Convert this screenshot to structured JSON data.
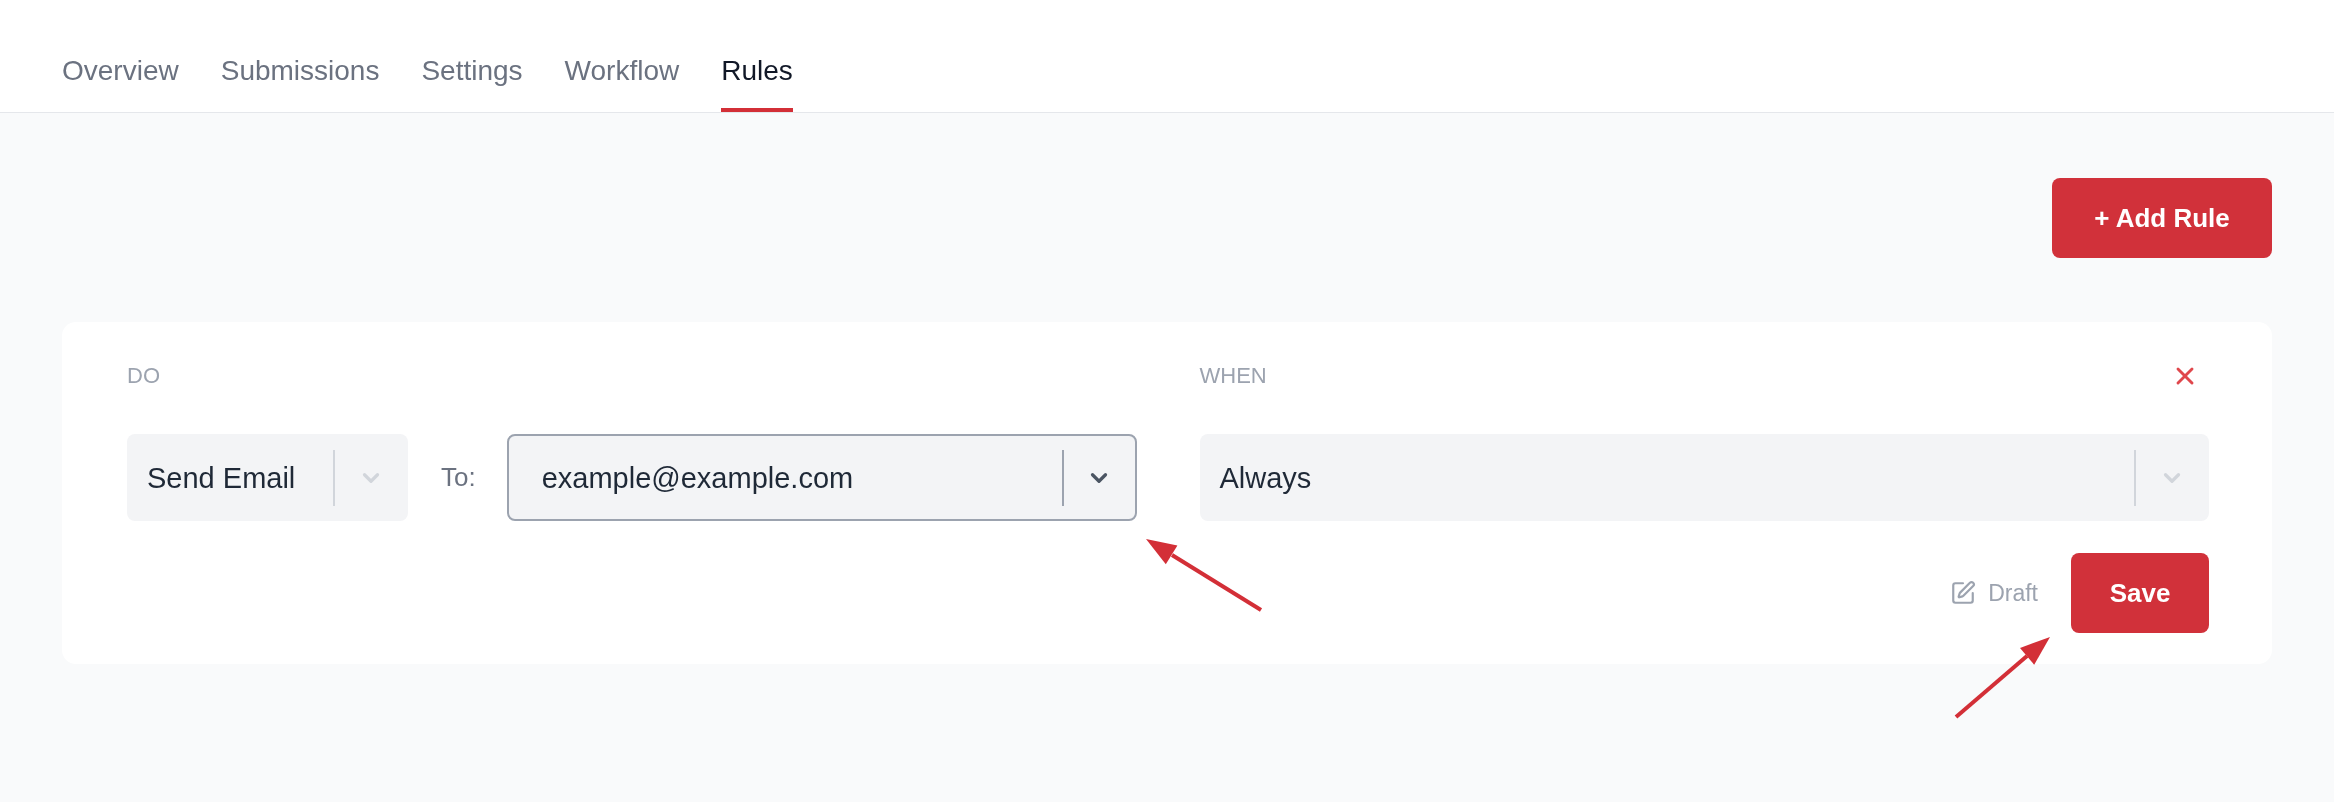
{
  "tabs": [
    {
      "label": "Overview",
      "selected": false
    },
    {
      "label": "Submissions",
      "selected": false
    },
    {
      "label": "Settings",
      "selected": false
    },
    {
      "label": "Workflow",
      "selected": false
    },
    {
      "label": "Rules",
      "selected": true
    }
  ],
  "add_rule_button": {
    "label": "+ Add Rule"
  },
  "rule": {
    "do": {
      "label": "DO",
      "action": {
        "value": "Send Email",
        "focused": false
      },
      "to_label": "To:",
      "recipient": {
        "value": "example@example.com",
        "focused": true
      }
    },
    "when": {
      "label": "WHEN",
      "condition": {
        "value": "Always",
        "focused": false
      }
    },
    "status": {
      "label": "Draft"
    },
    "save_button": {
      "label": "Save"
    }
  }
}
